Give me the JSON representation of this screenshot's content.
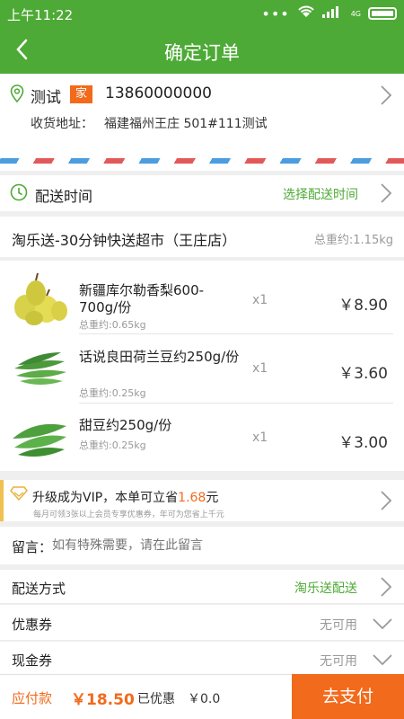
{
  "status_bar": {
    "time": "上午11:22",
    "network_label": "4G",
    "battery": "battery"
  },
  "nav": {
    "title": "确定订单",
    "back_icon": "back-arrow"
  },
  "address": {
    "name": "测试",
    "tag": "家",
    "phone": "13860000000",
    "label": "收货地址：",
    "address": "福建福州王庄 501#111测试"
  },
  "delivery_time": {
    "label": "配送时间",
    "action": "选择配送时间"
  },
  "store": {
    "name": "淘乐送-30分钟快送超市（王庄店）",
    "weight": "总重约:1.15kg"
  },
  "items": [
    {
      "name": "新疆库尔勒香梨600-700g/份",
      "weight": "总重约:0.65kg",
      "qty": "x1",
      "price": "￥8.90",
      "icon": "pear-image"
    },
    {
      "name": "话说良田荷兰豆约250g/份",
      "weight": "总重约:0.25kg",
      "qty": "x1",
      "price": "￥3.60",
      "icon": "snow-pea-image"
    },
    {
      "name": "甜豆约250g/份",
      "weight": "总重约:0.25kg",
      "qty": "x1",
      "price": "￥3.00",
      "icon": "sweet-pea-image"
    }
  ],
  "vip": {
    "prefix": "升级成为VIP，本单可立省",
    "amount": "1.68",
    "suffix": "元",
    "note": "每月可领3张以上会员专享优惠券，年可为您省上千元"
  },
  "message": {
    "label": "留言：",
    "placeholder": "如有特殊需要，请在此留言"
  },
  "options": [
    {
      "label": "配送方式",
      "value": "淘乐送配送",
      "value_color": "#4eaa36"
    },
    {
      "label": "优惠券",
      "value": "无可用",
      "value_color": "#999999"
    },
    {
      "label": "现金券",
      "value": "无可用",
      "value_color": "#999999"
    }
  ],
  "bottom": {
    "due_label": "应付款",
    "due_amount": "￥18.50",
    "discount_label": "已优惠",
    "discount_amount": "￥0.0",
    "pay_button": "去支付"
  },
  "colors": {
    "brand": "#4eaa36",
    "accent": "#f26a1b",
    "tag": "#f26a1b"
  }
}
